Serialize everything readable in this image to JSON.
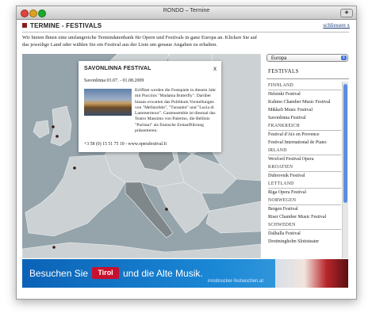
{
  "window": {
    "title": "RONDO – Termine"
  },
  "header": {
    "title": "TERMINE - FESTIVALS",
    "close_link": "schliessen x"
  },
  "intro": "Wir bieten Ihnen eine umfangreiche Termindatenbank für Opern und Festivals in ganz Europa an. Klicken Sie auf das jeweilige Land oder wählen Sie ein Festival aus der Liste um genaue Angaben zu erhalten.",
  "popup": {
    "title": "SAVONLINNA FESTIVAL",
    "close": "x",
    "date": "Savonlinna 03.07. - 01.08.2009",
    "text": "Eröffnet werden die Festspiele in diesem Jahr mit Puccinis \"Madama Butterfly\". Darüber hinaus erwarten das Publikum Vorstellungen von \"Mefistofele\", \"Turandot\" und \"Lucia di Lammermoor\". Gastensemble ist diesmal das Teatro Massimo von Palermo, die Bellinis \"Puritani\" als finnische Erstaufführung präsentieren.",
    "contact": "+3 58 (0) 15 51 75 10 - www.operafestival.fi"
  },
  "region_select": {
    "value": "Europa"
  },
  "list": {
    "title": "FESTIVALS",
    "rows": [
      {
        "text": "FINNLAND",
        "type": "c"
      },
      {
        "text": "Helsinki Festival",
        "type": "f"
      },
      {
        "text": "Kuhmo Chamber Music Festival",
        "type": "f"
      },
      {
        "text": "Mikkeli Music Festival",
        "type": "f"
      },
      {
        "text": "Savonlinna Festival",
        "type": "f"
      },
      {
        "text": "FRANKREICH",
        "type": "c"
      },
      {
        "text": "Festival d'Aix en Provence",
        "type": "f"
      },
      {
        "text": "Festival International de Piano",
        "type": "f"
      },
      {
        "text": "IRLAND",
        "type": "c"
      },
      {
        "text": "Wexford Festival Opera",
        "type": "f"
      },
      {
        "text": "KROATIEN",
        "type": "c"
      },
      {
        "text": "Dubrovnik Festival",
        "type": "f"
      },
      {
        "text": "LETTLAND",
        "type": "c"
      },
      {
        "text": "Riga Opera Festival",
        "type": "f"
      },
      {
        "text": "NORWEGEN",
        "type": "c"
      },
      {
        "text": "Bergen Festival",
        "type": "f"
      },
      {
        "text": "Riser Chamber Music Festival",
        "type": "f"
      },
      {
        "text": "SCHWEDEN",
        "type": "c"
      },
      {
        "text": "Dalhalla Festival",
        "type": "f"
      },
      {
        "text": "Drottningholm Slottsteater",
        "type": "f"
      }
    ]
  },
  "banner": {
    "text1": "Besuchen Sie",
    "logo": "Tirol",
    "text2": "und die Alte Musik.",
    "url": "innsbrucker-festwochen.at"
  },
  "colors": {
    "map_water": "#95a3ab",
    "map_land": "#ccd1d3",
    "highlight": "#7f878b",
    "brand_red": "#c8102e"
  }
}
